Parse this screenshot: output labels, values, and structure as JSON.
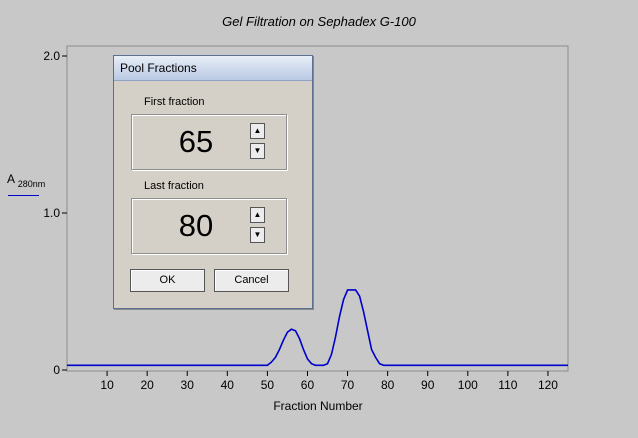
{
  "chart_data": {
    "type": "line",
    "title": "Gel Filtration on Sephadex G-100",
    "xlabel": "Fraction Number",
    "ylabel": "A",
    "ylabel_sub": "280nm",
    "xlim": [
      0,
      125
    ],
    "ylim": [
      0,
      2.0
    ],
    "x_ticks": [
      10,
      20,
      30,
      40,
      50,
      60,
      70,
      80,
      90,
      100,
      110,
      120
    ],
    "y_ticks": [
      0,
      1.0,
      2.0
    ],
    "y_tick_labels": [
      "0",
      "1.0",
      "2.0"
    ],
    "grid": false,
    "line_color": "#0000cc",
    "series": [
      {
        "x": [
          0,
          49,
          50,
          51,
          52,
          53,
          54,
          55,
          56,
          57,
          58,
          59,
          60,
          61,
          62,
          64,
          65,
          66,
          67,
          68,
          69,
          70,
          71,
          72,
          73,
          74,
          75,
          76,
          77,
          78,
          79,
          125
        ],
        "y": [
          0.03,
          0.03,
          0.03,
          0.05,
          0.08,
          0.13,
          0.19,
          0.24,
          0.26,
          0.25,
          0.2,
          0.13,
          0.07,
          0.04,
          0.03,
          0.03,
          0.04,
          0.1,
          0.21,
          0.34,
          0.45,
          0.51,
          0.51,
          0.51,
          0.47,
          0.37,
          0.25,
          0.13,
          0.08,
          0.04,
          0.03,
          0.03
        ]
      }
    ]
  },
  "dialog": {
    "title": "Pool Fractions",
    "first_label": "First fraction",
    "first_value": "65",
    "last_label": "Last fraction",
    "last_value": "80",
    "ok_label": "OK",
    "cancel_label": "Cancel",
    "spin_up": "▲",
    "spin_down": "▼"
  }
}
